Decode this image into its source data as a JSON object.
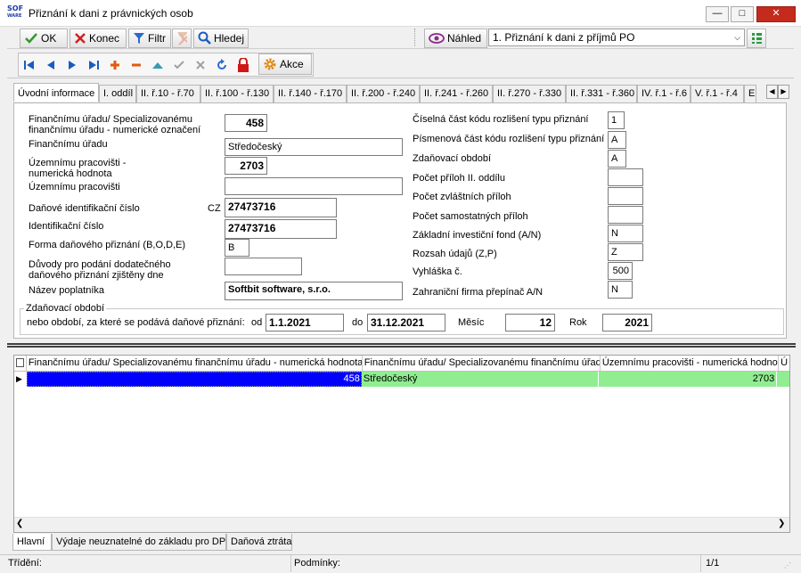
{
  "window": {
    "title": "Přiznání k dani z právnických osob",
    "logo_top": "SOF",
    "logo_bottom": "WARE"
  },
  "toolbar": {
    "ok": "OK",
    "konec": "Konec",
    "filtr": "Filtr",
    "hledej": "Hledej",
    "nahled": "Náhled",
    "report": "1. Přiznání k dani z příjmů PO",
    "akce": "Akce"
  },
  "tabs": [
    "Úvodní informace",
    "I. oddíl",
    "II. ř.10 - ř.70",
    "II. ř.100 - ř.130",
    "II. ř.140 - ř.170",
    "II. ř.200 - ř.240",
    "II. ř.241 - ř.260",
    "II. ř.270 - ř.330",
    "II. ř.331 - ř.360",
    "IV. ř.1 - ř.6",
    "V. ř.1 - ř.4",
    "E"
  ],
  "form": {
    "fu_num_label": "Finančnímu úřadu/ Specializovanému finančnímu úřadu - numerické označení",
    "fu_num_l1": "Finančnímu úřadu/ Specializovanému",
    "fu_num_l2": "finančnímu úřadu - numerické označení",
    "fu_num": "458",
    "fu_label": "Finančnímu úřadu",
    "fu": "Středočeský",
    "up_num_l1": "Územnímu pracovišti -",
    "up_num_l2": "numerická hodnota",
    "up_num": "2703",
    "up_label": "Územnímu pracovišti",
    "up": "",
    "dic_label": "Daňové identifikační číslo",
    "dic_prefix": "CZ",
    "dic": "27473716",
    "ic_label": "Identifikační číslo",
    "ic": "27473716",
    "forma_label": "Forma daňového přiznání  (B,O,D,E)",
    "forma": "B",
    "duvody_l1": "Důvody pro podání dodatečného",
    "duvody_l2": "daňového přiznání zjištěny dne",
    "duvody": "",
    "nazev_label": "Název poplatníka",
    "nazev": "Softbit software, s.r.o.",
    "r_ciselna_label": "Číselná část kódu rozlišení typu přiznání",
    "r_ciselna": "1",
    "r_pismenna_label": "Písmenová část kódu rozlišení typu přiznání",
    "r_pismenna": "A",
    "r_zdan_label": "Zdaňovací období",
    "r_zdan": "A",
    "r_prilohII_label": "Počet příloh II. oddílu",
    "r_prilohII": "",
    "r_zvlast_label": "Počet zvláštních příloh",
    "r_zvlast": "",
    "r_samost_label": "Počet samostatných příloh",
    "r_samost": "",
    "r_fond_label": "Základní investiční fond (A/N)",
    "r_fond": "N",
    "r_rozsah_label": "Rozsah údajů (Z,P)",
    "r_rozsah": "Z",
    "r_vyhl_label": "Vyhláška č.",
    "r_vyhl": "500",
    "r_zahr_label": "Zahraniční firma přepínač A/N",
    "r_zahr": "N"
  },
  "period": {
    "group": "Zdaňovací období",
    "label": "nebo období, za které se podává daňové přiznání:",
    "od_label": "od",
    "od": "1.1.2021",
    "do_label": "do",
    "do": "31.12.2021",
    "mesic_label": "Měsíc",
    "mesic": "12",
    "rok_label": "Rok",
    "rok": "2021"
  },
  "grid": {
    "headers": [
      "Finančnímu úřadu/ Specializovanému finančnímu úřadu - numerická hodnota",
      "Finančnímu úřadu/ Specializovanému finančnímu úřadu",
      "Územnímu pracovišti - numerická hodnota",
      "Ú"
    ],
    "row": [
      "458",
      "Středočeský",
      "2703",
      ""
    ]
  },
  "bottom_tabs": [
    "Hlavní",
    "Výdaje neuznatelné do základu pro DP",
    "Daňová ztráta"
  ],
  "status": {
    "trideni": "Třídění:",
    "podminky": "Podmínky:",
    "pages": "1/1"
  },
  "colors": {
    "selected": "#0000ff",
    "row": "#90ee90",
    "accent": "#1a3ea8"
  }
}
